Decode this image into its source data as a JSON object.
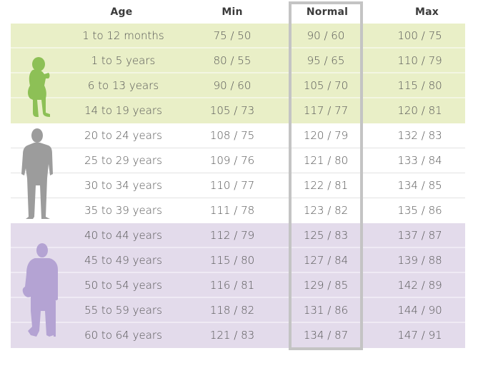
{
  "header": {
    "age": "Age",
    "min": "Min",
    "normal": "Normal",
    "max": "Max"
  },
  "groups": [
    {
      "name": "child",
      "icon": "child-silhouette-icon",
      "color": "#8dc056",
      "band_color": "#e9efc7"
    },
    {
      "name": "adult",
      "icon": "adult-silhouette-icon",
      "color": "#9c9c9c",
      "band_color": "#ffffff"
    },
    {
      "name": "senior",
      "icon": "senior-silhouette-icon",
      "color": "#b4a3d3",
      "band_color": "#e3dbeb"
    }
  ],
  "highlight_color": "#c4c4c4",
  "rows": [
    {
      "age": "1 to 12 months",
      "min": "75 / 50",
      "normal": "90 / 60",
      "max": "100 / 75",
      "group": "child"
    },
    {
      "age": "1 to 5 years",
      "min": "80 / 55",
      "normal": "95 / 65",
      "max": "110 / 79",
      "group": "child"
    },
    {
      "age": "6 to 13 years",
      "min": "90 / 60",
      "normal": "105 / 70",
      "max": "115 / 80",
      "group": "child"
    },
    {
      "age": "14 to 19 years",
      "min": "105 / 73",
      "normal": "117 / 77",
      "max": "120 / 81",
      "group": "child"
    },
    {
      "age": "20 to 24 years",
      "min": "108 / 75",
      "normal": "120 / 79",
      "max": "132 / 83",
      "group": "adult"
    },
    {
      "age": "25 to 29 years",
      "min": "109 / 76",
      "normal": "121 / 80",
      "max": "133 / 84",
      "group": "adult"
    },
    {
      "age": "30 to 34 years",
      "min": "110 / 77",
      "normal": "122 / 81",
      "max": "134 / 85",
      "group": "adult"
    },
    {
      "age": "35 to 39 years",
      "min": "111 / 78",
      "normal": "123 / 82",
      "max": "135 / 86",
      "group": "adult"
    },
    {
      "age": "40 to 44 years",
      "min": "112 / 79",
      "normal": "125 / 83",
      "max": "137 / 87",
      "group": "senior"
    },
    {
      "age": "45 to 49 years",
      "min": "115 / 80",
      "normal": "127 / 84",
      "max": "139 / 88",
      "group": "senior"
    },
    {
      "age": "50 to 54 years",
      "min": "116 / 81",
      "normal": "129 / 85",
      "max": "142 / 89",
      "group": "senior"
    },
    {
      "age": "55 to 59 years",
      "min": "118 / 82",
      "normal": "131 / 86",
      "max": "144 / 90",
      "group": "senior"
    },
    {
      "age": "60 to 64 years",
      "min": "121 / 83",
      "normal": "134 / 87",
      "max": "147 / 91",
      "group": "senior"
    }
  ]
}
